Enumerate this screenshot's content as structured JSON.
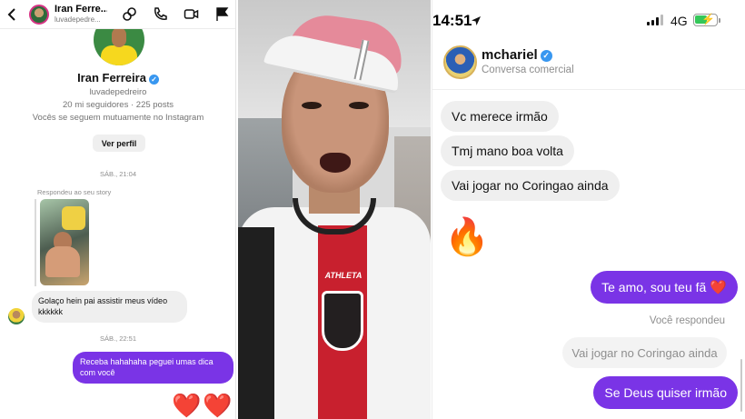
{
  "left": {
    "header": {
      "name": "Iran Ferre...",
      "username": "luvadepedre..."
    },
    "profile": {
      "name": "Iran Ferreira",
      "username": "luvadepedreiro",
      "stats": "20 mi seguidores · 225 posts",
      "mutual": "Vocês se seguem mutuamente no Instagram",
      "view_profile": "Ver perfil"
    },
    "timestamp1": "SÁB., 21:04",
    "reply_label": "Respondeu ao seu story",
    "incoming": "Golaço hein pai assistir meus vídeo kkkkkk",
    "timestamp2": "SÁB., 22:51",
    "outgoing": "Receba hahahaha peguei umas dica com você",
    "reaction": "❤️❤️"
  },
  "middle": {
    "shirt_brand": "ATHLETA"
  },
  "right": {
    "status": {
      "time": "14:51",
      "network": "4G"
    },
    "header": {
      "name": "mchariel",
      "subtitle": "Conversa comercial"
    },
    "incoming": [
      "Vc merece irmão",
      "Tmj mano boa volta",
      "Vai jogar no Coringao ainda"
    ],
    "fire": "🔥",
    "outgoing1": "Te amo, sou teu fã",
    "outgoing1_heart": "❤️",
    "you_replied": "Você respondeu",
    "quoted": "Vai jogar no Coringao ainda",
    "outgoing2": "Se Deus quiser irmão"
  },
  "colors": {
    "accent_purple": "#7a34e6",
    "verified_blue": "#3897f0",
    "bubble_gray": "#efefef"
  },
  "icons": [
    "back-icon",
    "link-icon",
    "phone-icon",
    "video-icon",
    "flag-icon",
    "location-arrow-icon",
    "signal-icon",
    "battery-icon"
  ]
}
